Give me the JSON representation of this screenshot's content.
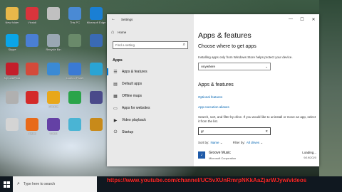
{
  "desktop": {
    "icons": [
      {
        "label": "New folder",
        "icon": "folder-icon",
        "color": "#e8b84a"
      },
      {
        "label": "Vivaldi",
        "icon": "vivaldi-icon",
        "color": "#d9343c"
      },
      {
        "label": "",
        "icon": "app-icon",
        "color": "#c0c0c0"
      },
      {
        "label": "This PC",
        "icon": "computer-icon",
        "color": "#4a8ad4"
      },
      {
        "label": "Microsoft Edge",
        "icon": "edge-icon",
        "color": "#1a7fd4"
      },
      {
        "label": "Skype",
        "icon": "skype-icon",
        "color": "#0aa5e8"
      },
      {
        "label": "",
        "icon": "app-icon",
        "color": "#4a7fd4"
      },
      {
        "label": "Recycle Bin",
        "icon": "recycle-bin-icon",
        "color": "#9aa7b3"
      },
      {
        "label": "",
        "icon": "app-icon",
        "color": "#6a8a6a"
      },
      {
        "label": "",
        "icon": "app-icon",
        "color": "#3a6ab4"
      },
      {
        "label": "My LastPass",
        "icon": "lastpass-icon",
        "color": "#c41e2a"
      },
      {
        "label": "",
        "icon": "app-icon",
        "color": "#d44a3a"
      },
      {
        "label": "",
        "icon": "app-icon",
        "color": "#3a8ad4"
      },
      {
        "label": "Control Panel",
        "icon": "control-panel-icon",
        "color": "#3a7ad4"
      },
      {
        "label": "",
        "icon": "app-icon",
        "color": "#2aa4d4"
      },
      {
        "label": "",
        "icon": "app-icon",
        "color": "#b0b0b0"
      },
      {
        "label": "",
        "icon": "app-icon",
        "color": "#d42a2a"
      },
      {
        "label": "Chrome",
        "icon": "chrome-icon",
        "color": "#e8a71a"
      },
      {
        "label": "",
        "icon": "app-icon",
        "color": "#2aa44a"
      },
      {
        "label": "",
        "icon": "app-icon",
        "color": "#4a4a8a"
      },
      {
        "label": "",
        "icon": "app-icon",
        "color": "#d4d4d4"
      },
      {
        "label": "Firefox",
        "icon": "firefox-icon",
        "color": "#e86a1a"
      },
      {
        "label": "Twitch",
        "icon": "twitch-icon",
        "color": "#6441a5"
      },
      {
        "label": "",
        "icon": "app-icon",
        "color": "#4ab4d4"
      },
      {
        "label": "",
        "icon": "app-icon",
        "color": "#c88a1a"
      }
    ]
  },
  "settings": {
    "window_title": "Settings",
    "home_label": "Home",
    "search_placeholder": "Find a setting",
    "section_label": "Apps",
    "nav": [
      {
        "label": "Apps & features",
        "icon": "list-icon",
        "active": true
      },
      {
        "label": "Default apps",
        "icon": "default-apps-icon",
        "active": false
      },
      {
        "label": "Offline maps",
        "icon": "map-icon",
        "active": false
      },
      {
        "label": "Apps for websites",
        "icon": "websites-icon",
        "active": false
      },
      {
        "label": "Video playback",
        "icon": "video-icon",
        "active": false
      },
      {
        "label": "Startup",
        "icon": "startup-icon",
        "active": false
      }
    ],
    "page_title": "Apps & features",
    "choose_heading": "Choose where to get apps",
    "choose_desc": "Installing apps only from Windows Store helps protect your device.",
    "source_value": "Anywhere",
    "af_heading": "Apps & features",
    "link_optional": "Optional features",
    "link_aliases": "App execution aliases",
    "search_desc": "Search, sort, and filter by drive. If you would like to uninstall or move an app, select it from the list.",
    "list_search_value": "gr",
    "sort_label": "Sort by:",
    "sort_value": "Name",
    "filter_label": "Filter by:",
    "filter_value": "All drives",
    "app": {
      "name": "Groove Music",
      "publisher": "Microsoft Corporation",
      "status": "Loading...",
      "date": "9/19/2020"
    }
  },
  "overlay": {
    "url": "https://www.youtube.com/channel/UC5vXUnRmrpNKkAaZjarWJyw/videos"
  },
  "taskbar": {
    "search_placeholder": "Type here to search",
    "tray_time": "",
    "tray_date": ""
  }
}
